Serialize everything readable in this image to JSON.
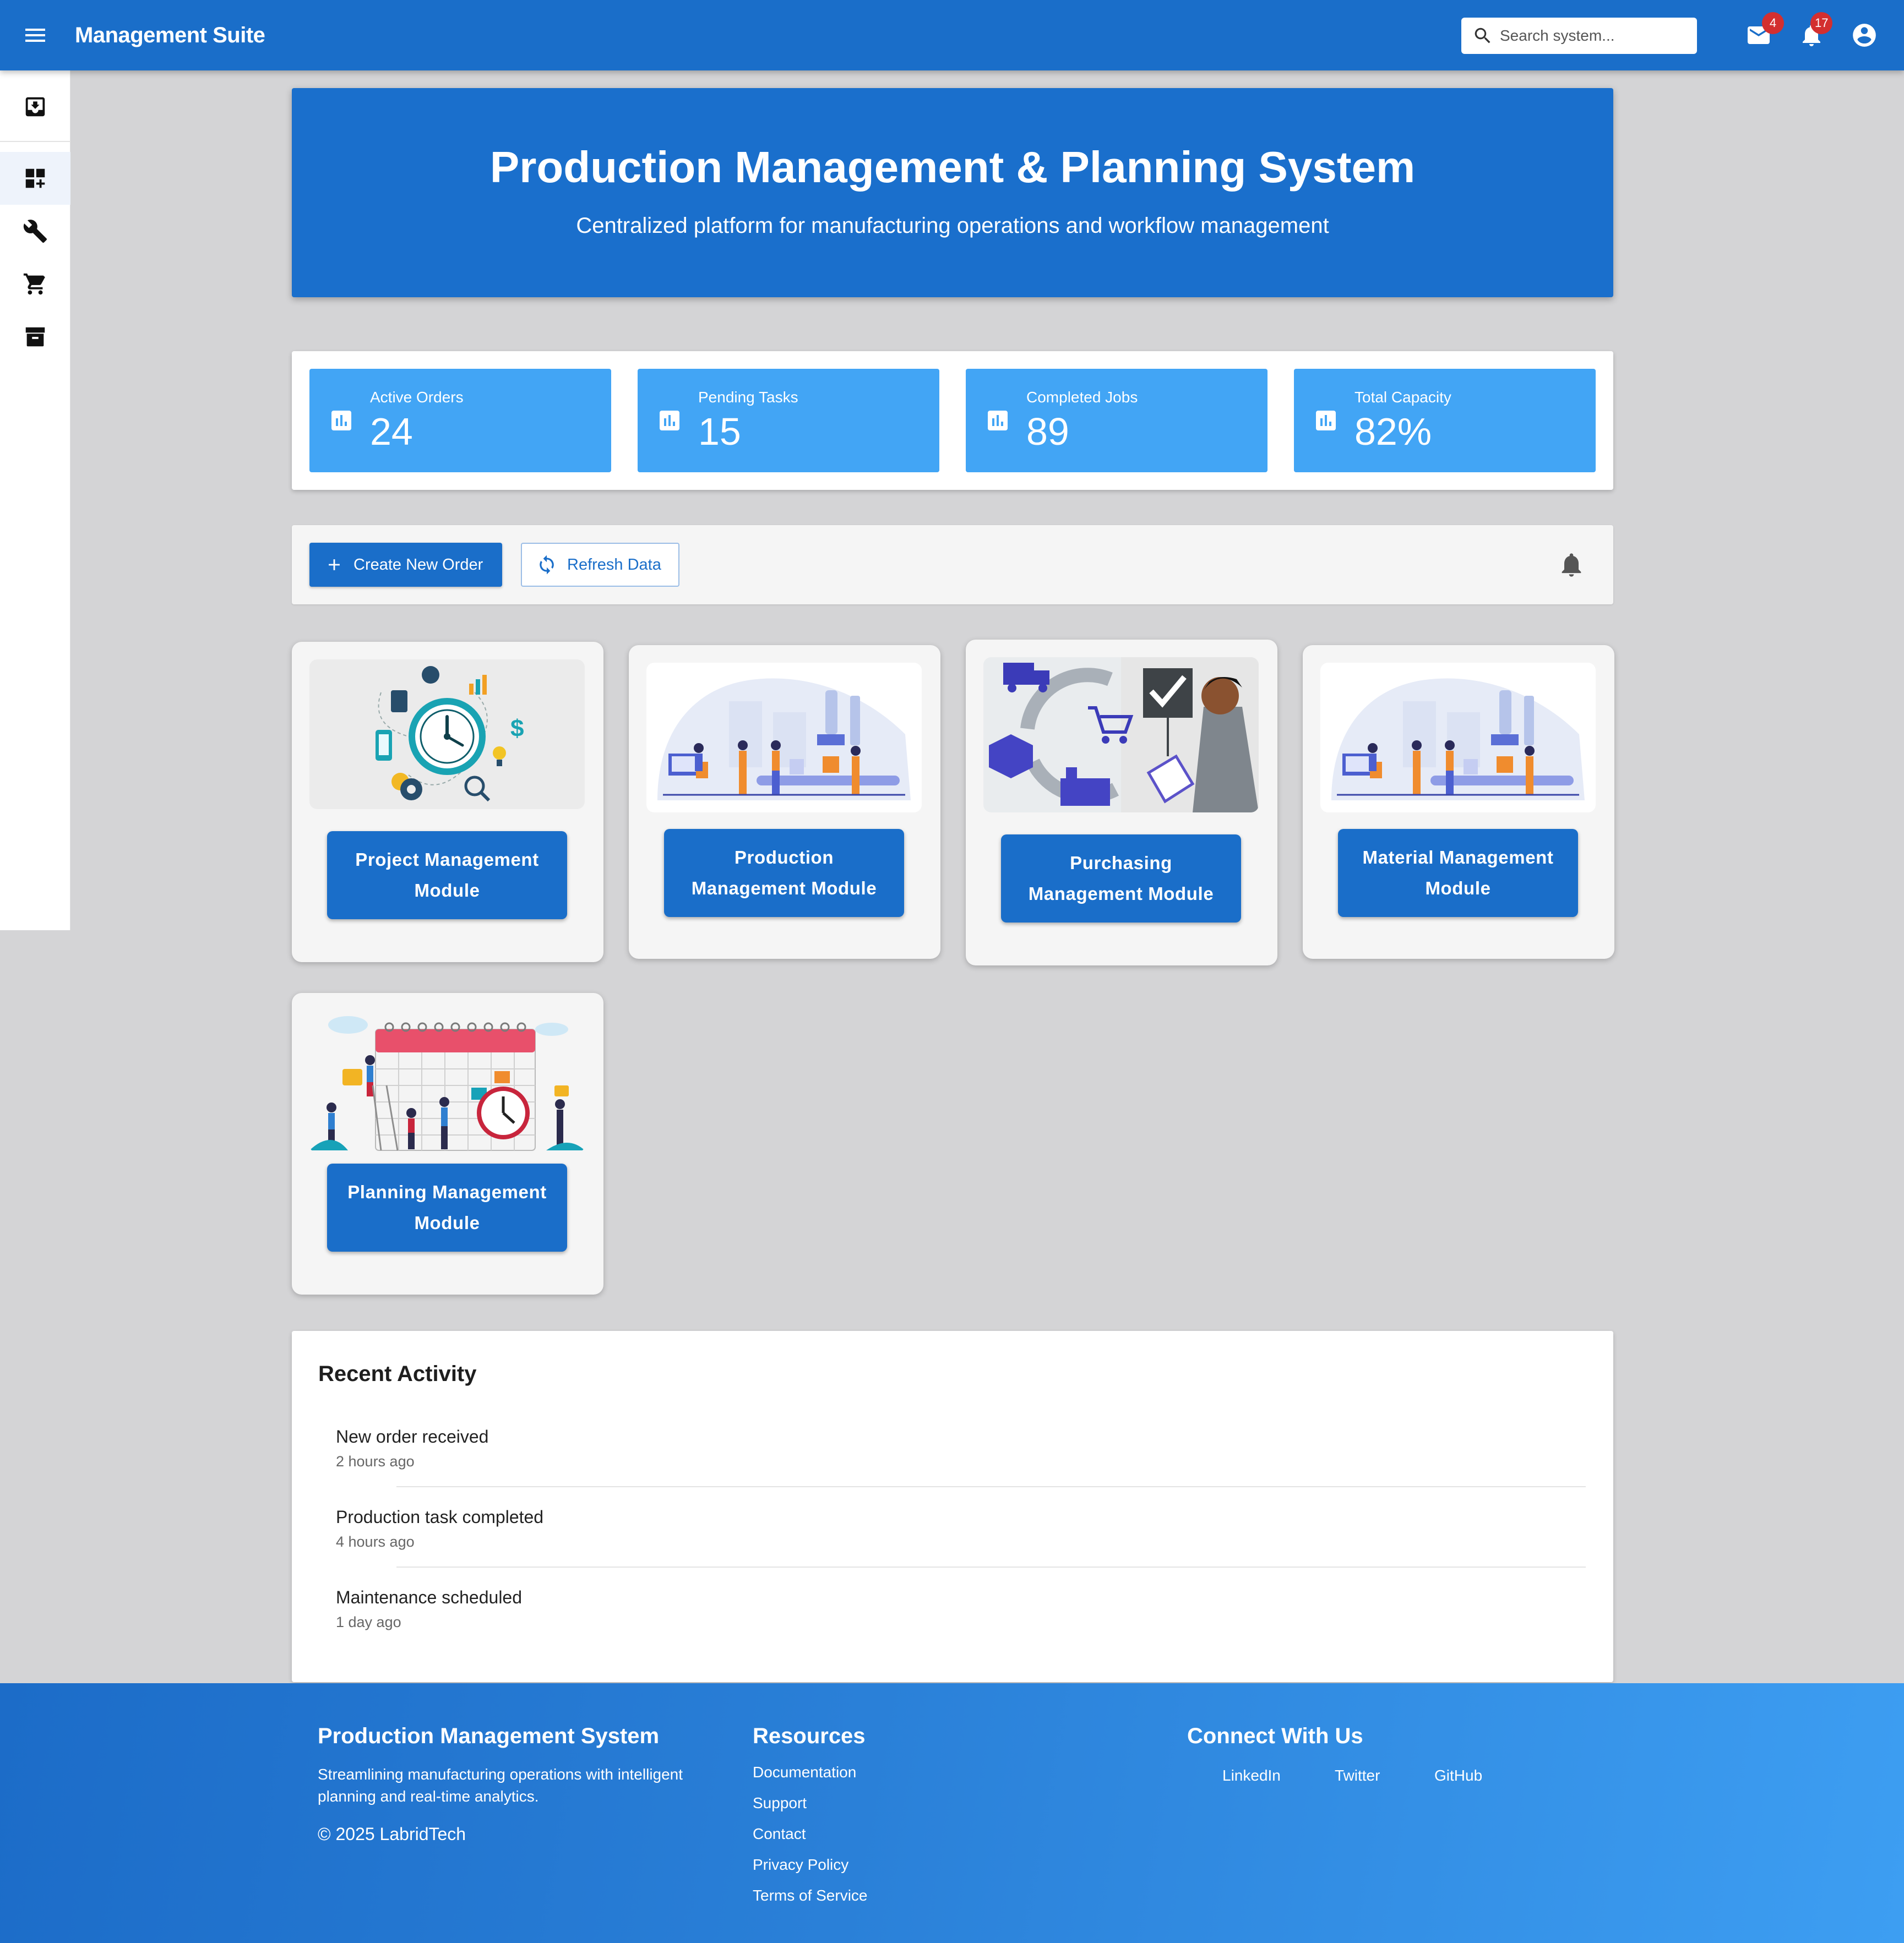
{
  "appbar": {
    "title": "Management Suite",
    "search_placeholder": "Search system...",
    "mail_badge": "4",
    "notification_badge": "17"
  },
  "sidebar": {
    "items": [
      {
        "icon": "inbox-download-icon"
      },
      {
        "icon": "dashboard-add-icon",
        "active": true
      },
      {
        "icon": "wrench-icon"
      },
      {
        "icon": "shopping-cart-icon"
      },
      {
        "icon": "archive-icon"
      }
    ]
  },
  "hero": {
    "title": "Production Management & Planning System",
    "subtitle": "Centralized platform for manufacturing operations and workflow management"
  },
  "stats": [
    {
      "label": "Active Orders",
      "value": "24"
    },
    {
      "label": "Pending Tasks",
      "value": "15"
    },
    {
      "label": "Completed Jobs",
      "value": "89"
    },
    {
      "label": "Total Capacity",
      "value": "82%"
    }
  ],
  "toolbar": {
    "create_label": "Create New Order",
    "refresh_label": "Refresh Data"
  },
  "modules": [
    {
      "label": "Project Management Module",
      "illustration": "clock-analytics-illustration"
    },
    {
      "label": "Production Management Module",
      "illustration": "factory-line-illustration"
    },
    {
      "label": "Purchasing Management Module",
      "illustration": "purchasing-cycle-illustration"
    },
    {
      "label": "Material Management Module",
      "illustration": "factory-line-illustration"
    },
    {
      "label": "Planning Management Module",
      "illustration": "calendar-team-illustration"
    }
  ],
  "activity": {
    "title": "Recent Activity",
    "items": [
      {
        "title": "New order received",
        "time": "2 hours ago"
      },
      {
        "title": "Production task completed",
        "time": "4 hours ago"
      },
      {
        "title": "Maintenance scheduled",
        "time": "1 day ago"
      }
    ]
  },
  "footer": {
    "brand_title": "Production Management System",
    "brand_desc": "Streamlining manufacturing operations with intelligent planning and real-time analytics.",
    "copyright": "© 2025 LabridTech",
    "resources_title": "Resources",
    "resources": [
      "Documentation",
      "Support",
      "Contact",
      "Privacy Policy",
      "Terms of Service"
    ],
    "connect_title": "Connect With Us",
    "social": [
      "LinkedIn",
      "Twitter",
      "GitHub"
    ]
  },
  "colors": {
    "primary": "#1a6ec9",
    "stat_card": "#42a5f5",
    "badge": "#d32f2f",
    "background": "#d4d4d6"
  }
}
